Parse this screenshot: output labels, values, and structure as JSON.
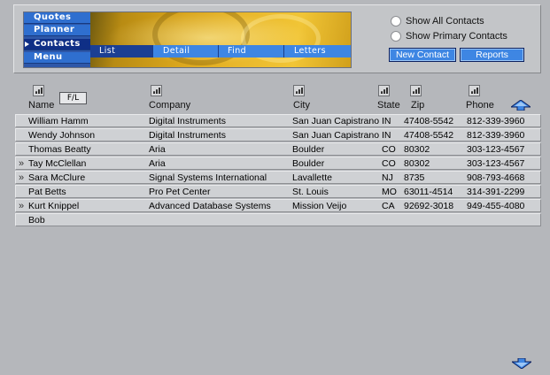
{
  "nav": {
    "menu": [
      {
        "label": "Quotes",
        "active": false
      },
      {
        "label": "Planner",
        "active": false
      },
      {
        "label": "Contacts",
        "active": true
      },
      {
        "label": "Menu",
        "active": false
      }
    ],
    "subtabs": [
      {
        "label": "List",
        "active": true
      },
      {
        "label": "Detail",
        "active": false
      },
      {
        "label": "Find",
        "active": false
      },
      {
        "label": "Letters",
        "active": false
      }
    ]
  },
  "filter": {
    "show_all_label": "Show All Contacts",
    "show_primary_label": "Show Primary Contacts"
  },
  "buttons": {
    "new_contact": "New Contact",
    "reports": "Reports"
  },
  "table": {
    "sort_toggle": "F/L",
    "columns": [
      "Name",
      "Company",
      "City",
      "State",
      "Zip",
      "Phone"
    ],
    "rows": [
      {
        "mark": "",
        "name": "William Hamm",
        "company": "Digital Instruments",
        "city": "San Juan Capistrano",
        "state": "IN",
        "zip": "47408-5542",
        "phone": "812-339-3960"
      },
      {
        "mark": "",
        "name": "Wendy Johnson",
        "company": "Digital Instruments",
        "city": "San Juan Capistrano",
        "state": "IN",
        "zip": "47408-5542",
        "phone": "812-339-3960"
      },
      {
        "mark": "",
        "name": "Thomas Beatty",
        "company": "Aria",
        "city": "Boulder",
        "state": "CO",
        "zip": "80302",
        "phone": "303-123-4567"
      },
      {
        "mark": "»",
        "name": "Tay McClellan",
        "company": "Aria",
        "city": "Boulder",
        "state": "CO",
        "zip": "80302",
        "phone": "303-123-4567"
      },
      {
        "mark": "»",
        "name": "Sara McClure",
        "company": "Signal Systems International",
        "city": "Lavallette",
        "state": "NJ",
        "zip": "8735",
        "phone": "908-793-4668"
      },
      {
        "mark": "",
        "name": "Pat Betts",
        "company": "Pro Pet Center",
        "city": "St. Louis",
        "state": "MO",
        "zip": "63011-4514",
        "phone": "314-391-2299"
      },
      {
        "mark": "»",
        "name": "Kurt Knippel",
        "company": "Advanced Database Systems",
        "city": "Mission Veijo",
        "state": "CA",
        "zip": "92692-3018",
        "phone": "949-455-4080"
      },
      {
        "mark": "",
        "name": "Bob",
        "company": "",
        "city": "",
        "state": "",
        "zip": "",
        "phone": ""
      }
    ]
  },
  "colors": {
    "menu_blue": "#2f6fcf",
    "menu_active": "#0f2f86",
    "button_blue": "#3e86e3",
    "background": "#b5b7bb"
  },
  "icons": {
    "column_sort": "bar-chart-icon",
    "scroll_up": "up-arrow-icon",
    "scroll_down": "down-arrow-icon",
    "active_menu": "triangle-pointer-icon"
  }
}
